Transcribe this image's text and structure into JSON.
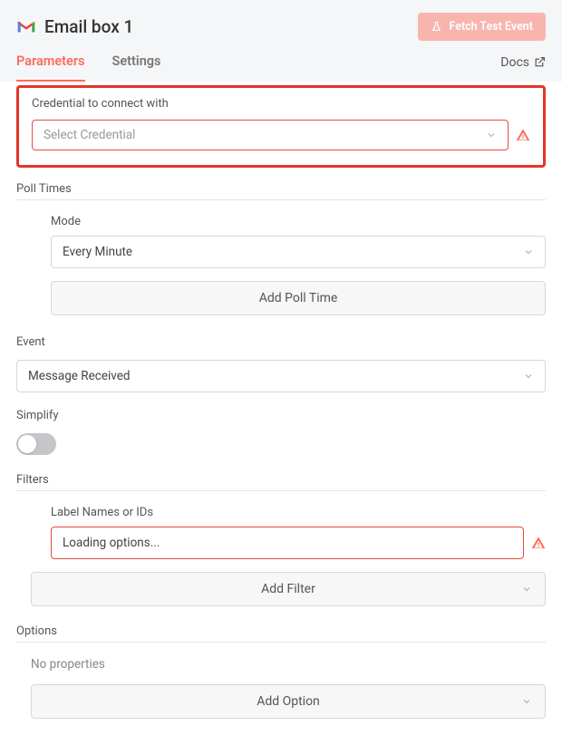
{
  "header": {
    "title": "Email box 1",
    "fetch_label": "Fetch Test Event"
  },
  "tabs": {
    "parameters": "Parameters",
    "settings": "Settings",
    "docs": "Docs"
  },
  "credential": {
    "label": "Credential to connect with",
    "placeholder": "Select Credential"
  },
  "poll": {
    "section": "Poll Times",
    "mode_label": "Mode",
    "mode_value": "Every Minute",
    "add_btn": "Add Poll Time"
  },
  "event": {
    "label": "Event",
    "value": "Message Received"
  },
  "simplify": {
    "label": "Simplify",
    "value": false
  },
  "filters": {
    "section": "Filters",
    "label_field": "Label Names or IDs",
    "loading": "Loading options...",
    "add_btn": "Add Filter"
  },
  "options": {
    "section": "Options",
    "no_props": "No properties",
    "add_btn": "Add Option"
  }
}
